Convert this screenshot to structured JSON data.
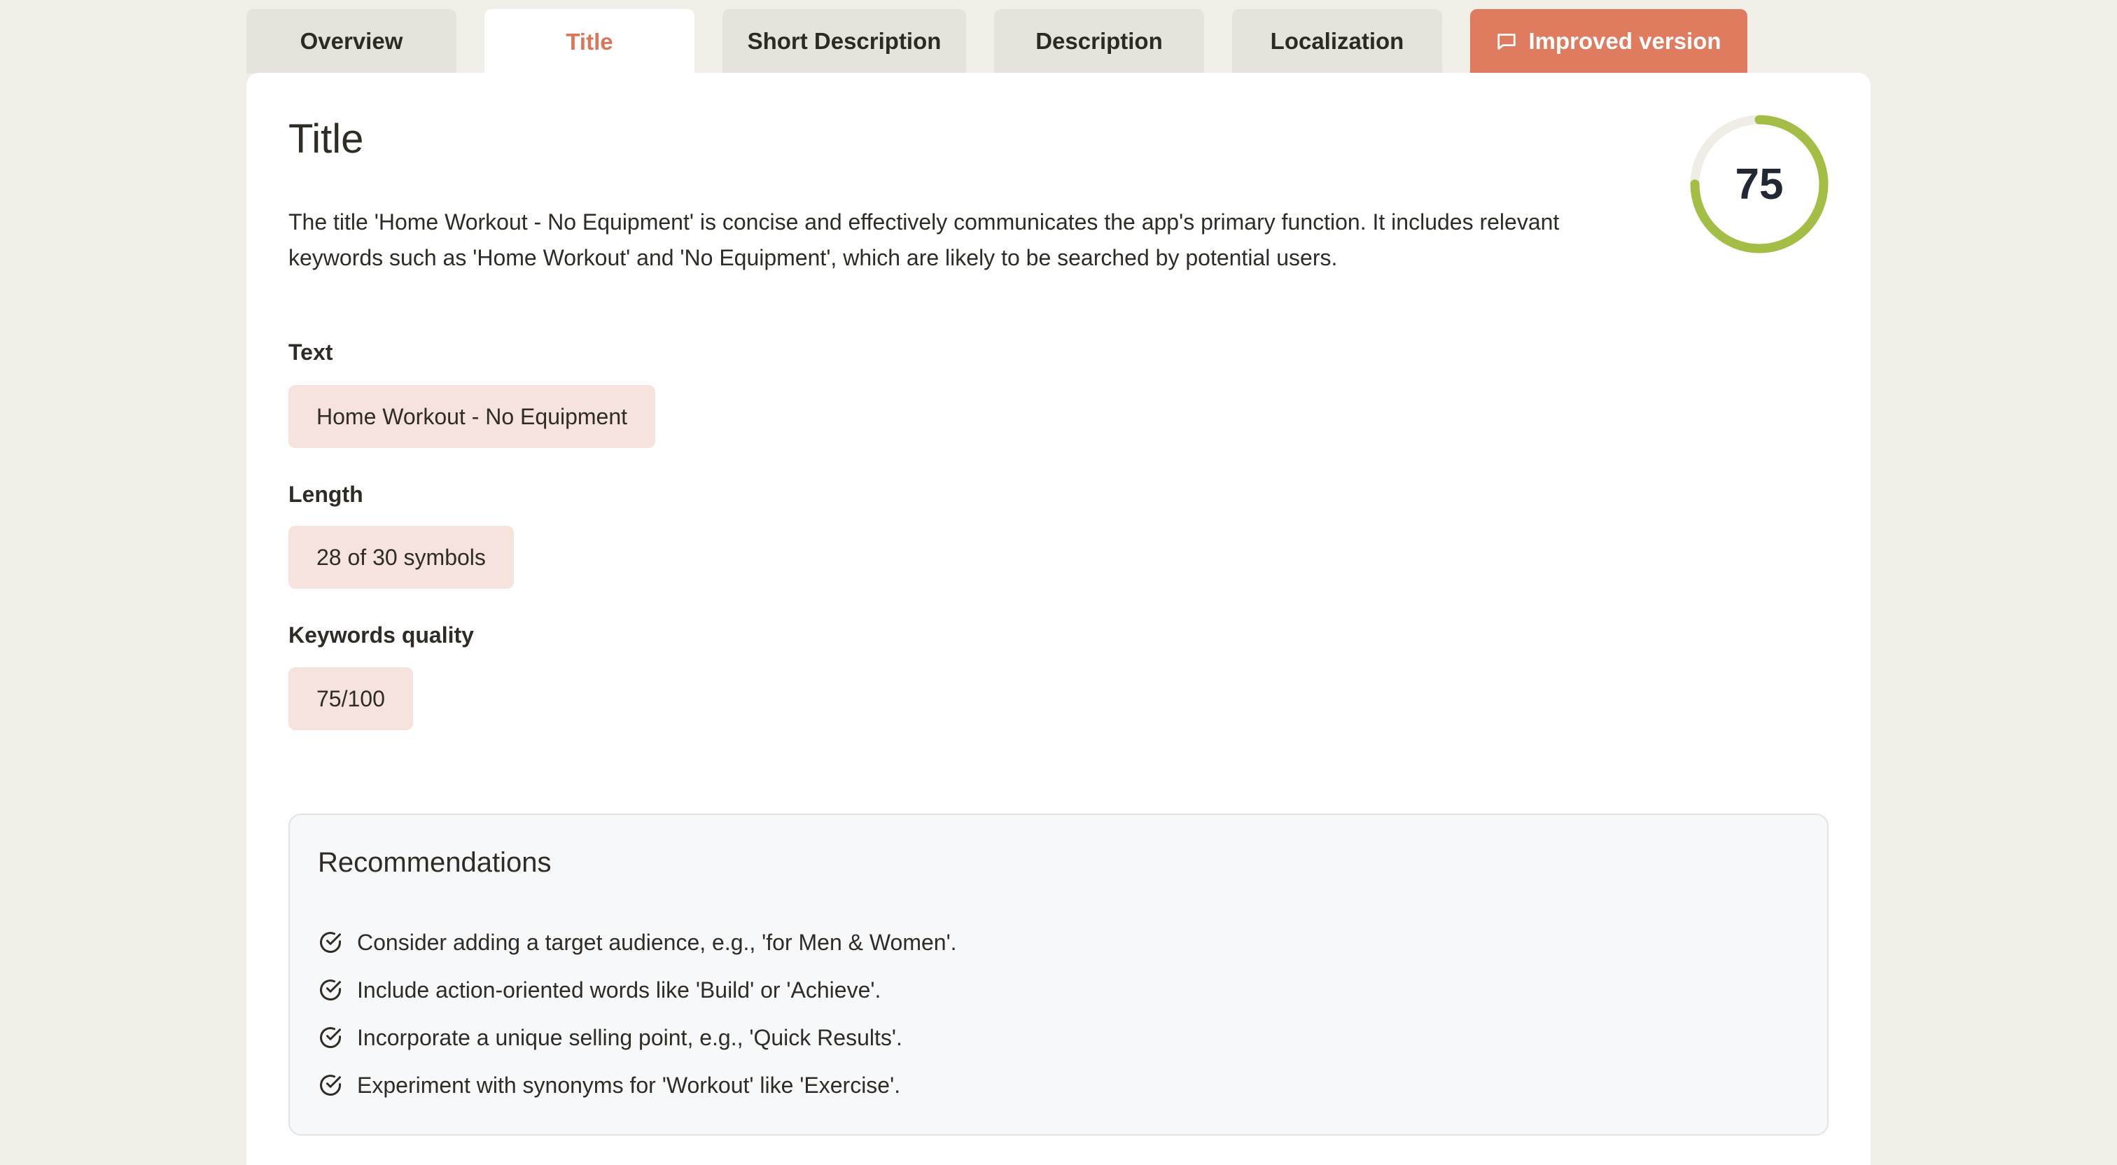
{
  "tabs": [
    {
      "label": "Overview"
    },
    {
      "label": "Title"
    },
    {
      "label": "Short Description"
    },
    {
      "label": "Description"
    },
    {
      "label": "Localization"
    },
    {
      "label": "Improved version"
    }
  ],
  "active_tab": "Title",
  "title_section": {
    "heading": "Title",
    "summary": "The title 'Home Workout - No Equipment' is concise and effectively communicates the app's primary function. It includes relevant keywords such as 'Home Workout' and 'No Equipment', which are likely to be searched by potential users.",
    "score": "75",
    "score_fraction": 0.75
  },
  "fields": {
    "text_label": "Text",
    "text_value": "Home Workout - No Equipment",
    "length_label": "Length",
    "length_value": "28 of 30 symbols",
    "keywords_label": "Keywords quality",
    "keywords_value": "75/100"
  },
  "recommendations": {
    "title": "Recommendations",
    "items": [
      "Consider adding a target audience, e.g., 'for Men & Women'.",
      "Include action-oriented words like 'Build' or 'Achieve'.",
      "Incorporate a unique selling point, e.g., 'Quick Results'.",
      "Experiment with synonyms for 'Workout' like 'Exercise'."
    ]
  },
  "colors": {
    "accent": "#df7b5e",
    "score_ring": "#a4bd45",
    "score_track": "#efede6",
    "chip_bg": "#f6e3dd",
    "page_bg": "#f1efe8"
  },
  "icons": {
    "improved_tab": "message-square-icon",
    "recommendation": "check-circle-icon"
  }
}
